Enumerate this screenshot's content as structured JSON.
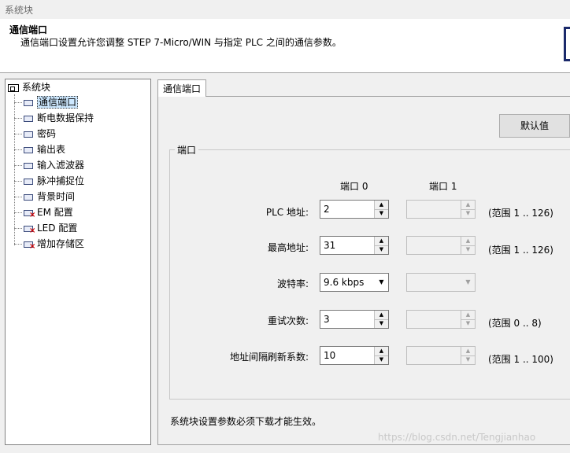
{
  "window": {
    "title": "系统块"
  },
  "header": {
    "title": "通信端口",
    "description": "通信端口设置允许您调整 STEP 7-Micro/WIN 与指定 PLC 之间的通信参数。"
  },
  "tree": {
    "root": "系统块",
    "items": [
      {
        "label": "通信端口",
        "icon": "module-icon"
      },
      {
        "label": "断电数据保持",
        "icon": "module-icon"
      },
      {
        "label": "密码",
        "icon": "module-icon"
      },
      {
        "label": "输出表",
        "icon": "module-icon"
      },
      {
        "label": "输入滤波器",
        "icon": "module-icon"
      },
      {
        "label": "脉冲捕捉位",
        "icon": "module-icon"
      },
      {
        "label": "背景时间",
        "icon": "module-icon"
      },
      {
        "label": "EM 配置",
        "icon": "module-error-icon"
      },
      {
        "label": "LED 配置",
        "icon": "module-error-icon"
      },
      {
        "label": "增加存储区",
        "icon": "module-error-icon"
      }
    ]
  },
  "tab": {
    "label": "通信端口"
  },
  "buttons": {
    "default_label": "默认值"
  },
  "group": {
    "label": "端口",
    "col_port0": "端口 0",
    "col_port1": "端口 1",
    "rows": [
      {
        "label": "PLC 地址:",
        "port0": "2",
        "range": "(范围 1 .. 126)"
      },
      {
        "label": "最高地址:",
        "port0": "31",
        "range": "(范围 1 .. 126)"
      },
      {
        "label": "波特率:",
        "port0": "9.6 kbps",
        "range": ""
      },
      {
        "label": "重试次数:",
        "port0": "3",
        "range": "(范围 0 .. 8)"
      },
      {
        "label": "地址间隔刷新系数:",
        "port0": "10",
        "range": "(范围 1 .. 100)"
      }
    ]
  },
  "footer": {
    "note": "系统块设置参数必须下载才能生效。"
  },
  "watermark": "https://blog.csdn.net/Tengjianhao",
  "colors": {
    "selection": "#cde8ff",
    "error_mark": "#d00000",
    "accent": "#1b2a6b"
  }
}
